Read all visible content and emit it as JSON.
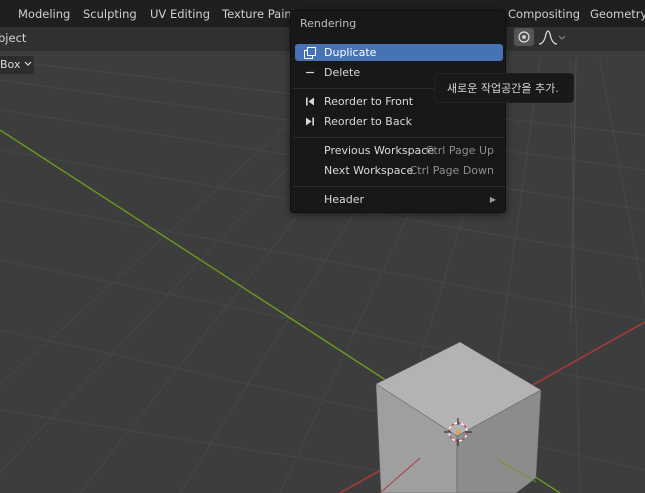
{
  "workspace_tabs": [
    "Modeling",
    "Sculpting",
    "UV Editing",
    "Texture Paint",
    "Compositing",
    "Geometry N"
  ],
  "header": {
    "mode_label": "bject",
    "select_box": "Box"
  },
  "menu": {
    "title": "Rendering",
    "items": [
      {
        "label": "Duplicate",
        "shortcut": "",
        "icon": "duplicate-icon",
        "active": true
      },
      {
        "label": "Delete",
        "shortcut": "",
        "icon": "minus-icon"
      },
      {
        "label": "Reorder to Front",
        "shortcut": "",
        "icon": "reorder-front-icon"
      },
      {
        "label": "Reorder to Back",
        "shortcut": "",
        "icon": "reorder-back-icon"
      },
      {
        "label": "Previous Workspace",
        "shortcut": "Ctrl Page Up"
      },
      {
        "label": "Next Workspace",
        "shortcut": "Ctrl Page Down"
      },
      {
        "label": "Header",
        "shortcut": "",
        "submenu": true
      }
    ]
  },
  "tooltip": "새로운 작업공간을 추가.",
  "colors": {
    "accent": "#4772b3",
    "x_axis": "#b03a3a",
    "y_axis": "#6b9a1f",
    "cube": "#9f9f9f"
  }
}
